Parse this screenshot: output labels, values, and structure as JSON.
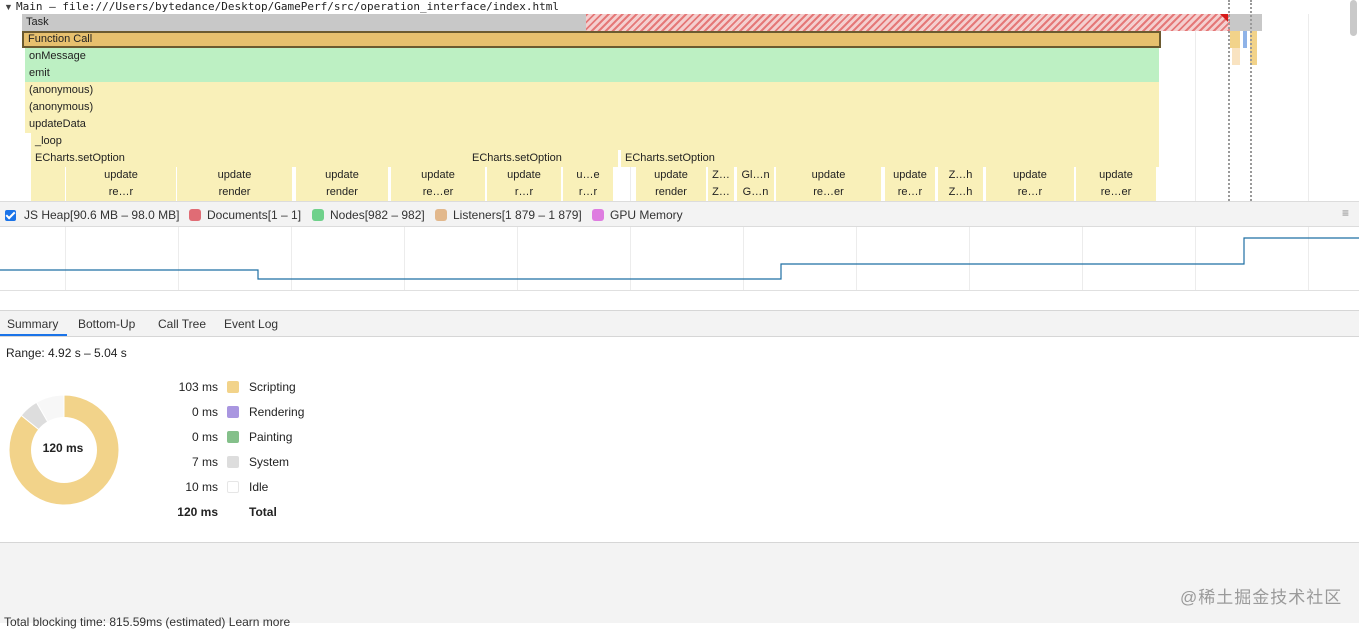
{
  "track": {
    "arrow": "▼",
    "title": "Main — file:///Users/bytedance/Desktop/GamePerf/src/operation_interface/index.html"
  },
  "flame": {
    "task": "Task",
    "function_call": "Function Call",
    "on_message": "onMessage",
    "emit": "emit",
    "anonymous_1": "(anonymous)",
    "anonymous_2": "(anonymous)",
    "update_data": "updateData",
    "loop": "_loop",
    "echarts_1": "ECharts.setOption",
    "echarts_2": "ECharts.setOption",
    "echarts_3": "ECharts.setOption",
    "update_labels": [
      "update",
      "update",
      "update",
      "update",
      "update",
      "u…e",
      "update",
      "Z…",
      "Gl…n",
      "update",
      "update",
      "Z…h",
      "update",
      "update"
    ],
    "render_labels": [
      "re…r",
      "render",
      "render",
      "re…er",
      "r…r",
      "r…r",
      "render",
      "Z…",
      "G…n",
      "re…er",
      "re…r",
      "Z…h",
      "re…r",
      "re…er"
    ]
  },
  "legend": {
    "js_heap": "JS Heap[90.6 MB – 98.0 MB]",
    "documents": "Documents[1 – 1]",
    "nodes": "Nodes[982 – 982]",
    "listeners": "Listeners[1 879 – 1 879]",
    "gpu_memory": "GPU Memory",
    "menu_icon": "≡",
    "colors": {
      "documents": "#e06c75",
      "nodes": "#6fd18b",
      "listeners": "#e2b88c",
      "gpu": "#de7ce0",
      "heap_line": "#1f6fa3"
    }
  },
  "tabs": [
    "Summary",
    "Bottom-Up",
    "Call Tree",
    "Event Log"
  ],
  "summary": {
    "range": "Range: 4.92 s – 5.04 s",
    "total_center": "120 ms",
    "rows": [
      {
        "ms": "103 ms",
        "label": "Scripting",
        "color": "#f2d38a"
      },
      {
        "ms": "0 ms",
        "label": "Rendering",
        "color": "#a996e0"
      },
      {
        "ms": "0 ms",
        "label": "Painting",
        "color": "#84c08a"
      },
      {
        "ms": "7 ms",
        "label": "System",
        "color": "#dddddd"
      },
      {
        "ms": "10 ms",
        "label": "Idle",
        "color": "#ffffff"
      }
    ],
    "total": {
      "ms": "120 ms",
      "label": "Total"
    }
  },
  "footer": "Total blocking time: 815.59ms (estimated) Learn more",
  "watermark": "@稀土掘金技术社区"
}
